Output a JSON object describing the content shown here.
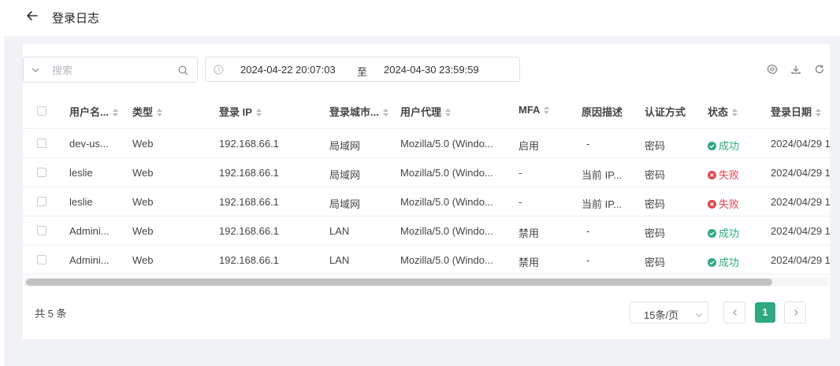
{
  "header": {
    "title": "登录日志"
  },
  "search": {
    "placeholder": "搜索",
    "value": ""
  },
  "date_range": {
    "start": "2024-04-22 20:07:03",
    "separator": "至",
    "end": "2024-04-30 23:59:59"
  },
  "toolbar": {
    "icons": [
      "settings-icon",
      "download-icon",
      "refresh-icon"
    ]
  },
  "table": {
    "columns": [
      "用户名...",
      "类型",
      "登录 IP",
      "登录城市...",
      "用户代理",
      "MFA",
      "原因描述",
      "认证方式",
      "状态",
      "登录日期"
    ],
    "rows": [
      {
        "username": "dev-us...",
        "type": "Web",
        "ip": "192.168.66.1",
        "city": "局域网",
        "agent": "Mozilla/5.0 (Windo...",
        "mfa": "启用",
        "reason": "-",
        "auth": "密码",
        "status": "成功",
        "date": "2024/04/29 1"
      },
      {
        "username": "leslie",
        "type": "Web",
        "ip": "192.168.66.1",
        "city": "局域网",
        "agent": "Mozilla/5.0 (Windo...",
        "mfa": "-",
        "reason": "当前 IP...",
        "auth": "密码",
        "status": "失败",
        "date": "2024/04/29 1"
      },
      {
        "username": "leslie",
        "type": "Web",
        "ip": "192.168.66.1",
        "city": "局域网",
        "agent": "Mozilla/5.0 (Windo...",
        "mfa": "-",
        "reason": "当前 IP...",
        "auth": "密码",
        "status": "失败",
        "date": "2024/04/29 1"
      },
      {
        "username": "Admini...",
        "type": "Web",
        "ip": "192.168.66.1",
        "city": "LAN",
        "agent": "Mozilla/5.0 (Windo...",
        "mfa": "禁用",
        "reason": "-",
        "auth": "密码",
        "status": "成功",
        "date": "2024/04/29 1"
      },
      {
        "username": "Admini...",
        "type": "Web",
        "ip": "192.168.66.1",
        "city": "LAN",
        "agent": "Mozilla/5.0 (Windo...",
        "mfa": "禁用",
        "reason": "-",
        "auth": "密码",
        "status": "成功",
        "date": "2024/04/29 1"
      }
    ]
  },
  "pagination": {
    "total": "共 5 条",
    "page_size": "15条/页",
    "current_page": "1"
  },
  "colors": {
    "accent": "#2eaa7e",
    "success": "#2eaa7e",
    "fail": "#e0454f",
    "background": "#f0f2f5"
  }
}
